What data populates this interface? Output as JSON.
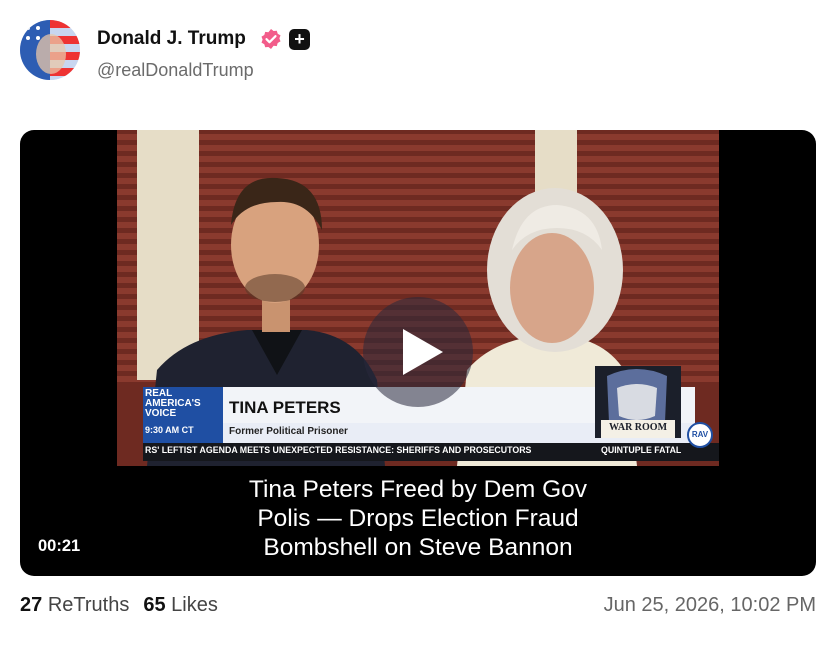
{
  "post": {
    "author_name": "Donald J. Trump",
    "author_handle": "@realDonaldTrump",
    "verified_icon": "verified-badge-icon",
    "plus_icon": "plus-square-icon",
    "timestamp": "Jun 25, 2026, 10:02 PM"
  },
  "video": {
    "duration": "00:21",
    "caption_lines": [
      "Tina Peters Freed by Dem Gov",
      "Polis — Drops Election Fraud",
      "Bombshell on Steve Bannon"
    ],
    "lower_third": {
      "network_logo": [
        "REAL",
        "AMERICA'S",
        "VOICE"
      ],
      "time": "9:30 AM CT",
      "name": "TINA PETERS",
      "title": "Former Political Prisoner",
      "ticker": "RS' LEFTIST AGENDA MEETS UNEXPECTED RESISTANCE: SHERIFFS AND PROSECUTORS",
      "ticker_right": "QUINTUPLE FATAL",
      "show_logo": "WAR ROOM",
      "rav_bug": "RAV"
    }
  },
  "stats": {
    "retruths_count": "27",
    "retruths_label": "ReTruths",
    "likes_count": "65",
    "likes_label": "Likes"
  },
  "colors": {
    "accent_verified": "#f25c8a",
    "chyron_blue": "#1f4fa3",
    "background_wall": "#7a2c22"
  }
}
